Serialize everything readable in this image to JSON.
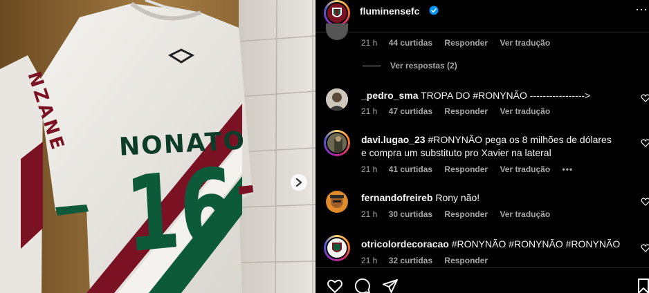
{
  "post": {
    "username": "fluminensefc",
    "verified": true,
    "more_icon": "⋯"
  },
  "photo": {
    "jersey_name": "NONATO",
    "jersey_number": "16",
    "side_jersey_text": "NZANE"
  },
  "top_meta": {
    "time": "21 h",
    "likes": "44 curtidas",
    "reply": "Responder",
    "translate": "Ver tradução"
  },
  "replies_toggle": "Ver respostas (2)",
  "comments": [
    {
      "username": "_pedro_sma",
      "text": "TROPA DO #RONYNÃO ----------------->",
      "time": "21 h",
      "likes": "47 curtidas",
      "reply": "Responder",
      "translate": "Ver tradução"
    },
    {
      "username": "davi.lugao_23",
      "text": "#RONYNÃO pega os 8 milhões de dólares e compra um substituto pro Xavier na lateral",
      "time": "21 h",
      "likes": "41 curtidas",
      "reply": "Responder",
      "translate": "Ver tradução",
      "more": "•••"
    },
    {
      "username": "fernandofreireb",
      "text": "Rony não!",
      "time": "21 h",
      "likes": "30 curtidas",
      "reply": "Responder",
      "translate": "Ver tradução"
    },
    {
      "username": "otricolordecoracao",
      "text": "#RONYNÃO #RONYNÃO #RONYNÃO",
      "time": "21 h",
      "likes": "32 curtidas",
      "reply": "Responder"
    }
  ],
  "colors": {
    "background": "#000000",
    "text": "#f5f5f5",
    "muted": "#a8a8a8",
    "verified": "#0095f6",
    "club_grena": "#7a1224",
    "club_green": "#0d5a3a"
  }
}
